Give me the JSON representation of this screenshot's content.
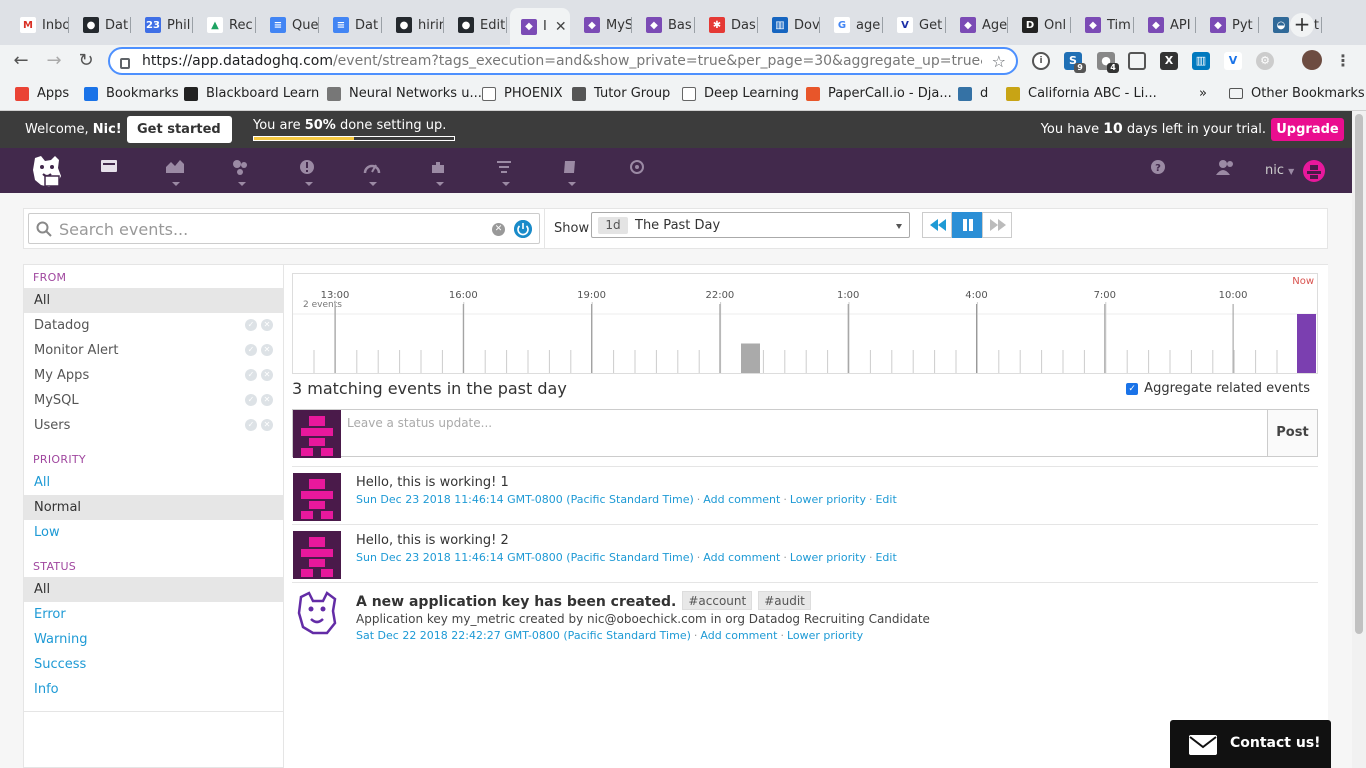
{
  "browser": {
    "tabs": [
      {
        "label": "Inbo",
        "color": "#ffffff",
        "glyph": "M",
        "glyph_color": "#d93025"
      },
      {
        "label": "Dat",
        "color": "#24292e",
        "glyph": "●"
      },
      {
        "label": "Phil",
        "color": "#3f6fe6",
        "glyph": "23"
      },
      {
        "label": "Rec",
        "color": "#ffffff",
        "glyph": "▲",
        "glyph_color": "#1ea362"
      },
      {
        "label": "Que",
        "color": "#4285f4",
        "glyph": "≡"
      },
      {
        "label": "Dat",
        "color": "#4285f4",
        "glyph": "≡"
      },
      {
        "label": "hirir",
        "color": "#24292e",
        "glyph": "●"
      },
      {
        "label": "Edit",
        "color": "#24292e",
        "glyph": "●"
      },
      {
        "label": "I",
        "color": "#7b4bb5",
        "glyph": "◆",
        "active": true
      },
      {
        "label": "MyS",
        "color": "#7b4bb5",
        "glyph": "◆"
      },
      {
        "label": "Bas",
        "color": "#7b4bb5",
        "glyph": "◆"
      },
      {
        "label": "Das",
        "color": "#e53935",
        "glyph": "✱"
      },
      {
        "label": "Dov",
        "color": "#1565c0",
        "glyph": "▥"
      },
      {
        "label": "age",
        "color": "#ffffff",
        "glyph": "G",
        "glyph_color": "#4285f4"
      },
      {
        "label": "Get",
        "color": "#ffffff",
        "glyph": "V",
        "glyph_color": "#1b2fa8"
      },
      {
        "label": "Age",
        "color": "#7b4bb5",
        "glyph": "◆"
      },
      {
        "label": "Onl",
        "color": "#222222",
        "glyph": "D"
      },
      {
        "label": "Tim",
        "color": "#7b4bb5",
        "glyph": "◆"
      },
      {
        "label": "API",
        "color": "#7b4bb5",
        "glyph": "◆"
      },
      {
        "label": "Pyt",
        "color": "#7b4bb5",
        "glyph": "◆"
      },
      {
        "label": "Inst",
        "color": "#306998",
        "glyph": "◒"
      }
    ],
    "new_tab": "+",
    "url_host": "https://app.datadoghq.com",
    "url_path": "/event/stream?tags_execution=and&show_private=true&per_page=30&aggregate_up=true&use_dat...",
    "extension_badges": [
      "9",
      "4"
    ],
    "bookmarks": [
      {
        "label": "Apps",
        "color": "#ea4335"
      },
      {
        "label": "Bookmarks",
        "color": "#1a73e8"
      },
      {
        "label": "Blackboard Learn",
        "color": "#222222"
      },
      {
        "label": "Neural Networks u...",
        "color": "#777777"
      },
      {
        "label": "PHOENIX",
        "color": "#ffffff"
      },
      {
        "label": "Tutor Group",
        "color": "#555555"
      },
      {
        "label": "Deep Learning",
        "color": "#ffffff"
      },
      {
        "label": "PaperCall.io - Dja...",
        "color": "#e8562a"
      },
      {
        "label": "d",
        "color": "#3572a5"
      },
      {
        "label": "California ABC - Li...",
        "color": "#c8a415"
      }
    ],
    "bookmarks_overflow": "»",
    "other_bookmarks": "Other Bookmarks"
  },
  "header": {
    "welcome_prefix": "Welcome, ",
    "welcome_name": "Nic!",
    "get_started": "Get started",
    "progress_prefix": "You are ",
    "progress_value": "50%",
    "progress_suffix": " done setting up.",
    "progress_fraction": 0.5,
    "trial_prefix": "You have ",
    "trial_days": "10",
    "trial_suffix": " days left in your trial.",
    "upgrade": "Upgrade",
    "user": "nic"
  },
  "search": {
    "placeholder": "Search events...",
    "show_label": "Show",
    "timeframe_chip": "1d",
    "timeframe_label": "The Past Day"
  },
  "filters": {
    "from": {
      "heading": "FROM",
      "items": [
        "All",
        "Datadog",
        "Monitor Alert",
        "My Apps",
        "MySQL",
        "Users"
      ],
      "selected": "All"
    },
    "priority": {
      "heading": "PRIORITY",
      "items": [
        "All",
        "Normal",
        "Low"
      ],
      "selected": "Normal"
    },
    "status": {
      "heading": "STATUS",
      "items": [
        "All",
        "Error",
        "Warning",
        "Success",
        "Info"
      ],
      "selected": "All"
    }
  },
  "timeline": {
    "hour_labels": [
      "13:00",
      "16:00",
      "19:00",
      "22:00",
      "1:00",
      "4:00",
      "7:00",
      "10:00"
    ],
    "now_label": "Now",
    "count_label": "2 events",
    "bars": [
      {
        "label": "22:00 +",
        "events": 1,
        "color": "#aaaaaa"
      },
      {
        "label": "Now",
        "events": 2,
        "color": "#7b3fb0"
      }
    ]
  },
  "stream": {
    "matching_text": "3 matching events in the past day",
    "aggregate_label": "Aggregate related events",
    "aggregate_checked": true,
    "status_placeholder": "Leave a status update...",
    "post_label": "Post",
    "events": [
      {
        "title": "Hello, this is working! 1",
        "timestamp": "Sun Dec 23 2018 11:46:14 GMT-0800 (Pacific Standard Time)",
        "actions": [
          "Add comment",
          "Lower priority",
          "Edit"
        ]
      },
      {
        "title": "Hello, this is working! 2",
        "timestamp": "Sun Dec 23 2018 11:46:14 GMT-0800 (Pacific Standard Time)",
        "actions": [
          "Add comment",
          "Lower priority",
          "Edit"
        ]
      },
      {
        "title": "A new application key has been created.",
        "tags": [
          "#account",
          "#audit"
        ],
        "body": "Application key my_metric created by nic@oboechick.com in org Datadog Recruiting Candidate",
        "timestamp": "Sat Dec 22 2018 22:42:27 GMT-0800 (Pacific Standard Time)",
        "actions": [
          "Add comment",
          "Lower priority"
        ]
      }
    ]
  },
  "contact": {
    "label": "Contact us!"
  },
  "colors": {
    "nav_bg": "#42294c",
    "accent_pink": "#ea0e8f",
    "link_blue": "#1e9ad5",
    "avatar_pink": "#e8189c",
    "avatar_dark": "#4a1a4a"
  }
}
